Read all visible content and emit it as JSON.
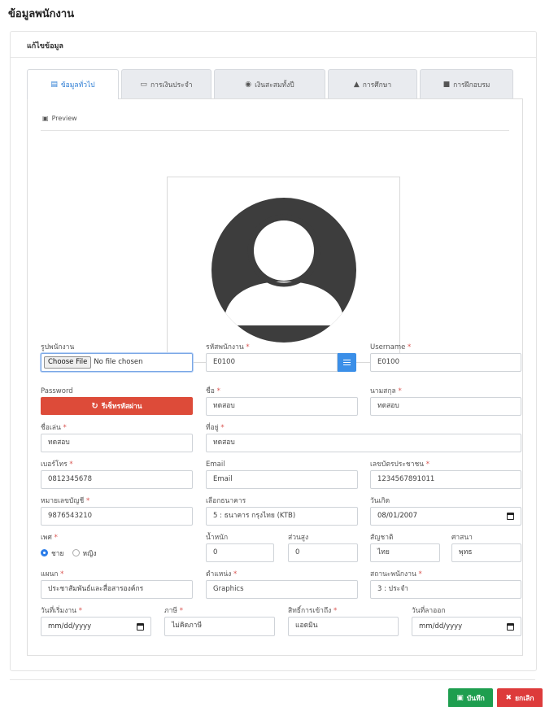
{
  "page_title": "ข้อมูลพนักงาน",
  "card_title": "แก้ไขข้อมูล",
  "tabs": [
    {
      "label": "ข้อมูลทั่วไป",
      "icon": "id-card-icon",
      "active": true
    },
    {
      "label": "การเงินประจำ",
      "icon": "money-icon",
      "active": false
    },
    {
      "label": "เงินสะสมทั้งปี",
      "icon": "piggy-bank-icon",
      "active": false
    },
    {
      "label": "การศึกษา",
      "icon": "graduation-cap-icon",
      "active": false
    },
    {
      "label": "การฝึกอบรม",
      "icon": "book-icon",
      "active": false
    }
  ],
  "preview_label": "Preview",
  "fields": {
    "photo": {
      "label": "รูปพนักงาน",
      "button": "Choose File",
      "status": "No file chosen"
    },
    "employee_code": {
      "label": "รหัสพนักงาน",
      "value": "E0100"
    },
    "username": {
      "label": "Username",
      "value": "E0100"
    },
    "password": {
      "label": "Password",
      "button": "รีเซ็ทรหัสผ่าน"
    },
    "first_name": {
      "label": "ชื่อ",
      "value": "ทดสอบ"
    },
    "last_name": {
      "label": "นามสกุล",
      "value": "ทดสอบ"
    },
    "nickname": {
      "label": "ชื่อเล่น",
      "value": "ทดสอบ"
    },
    "address": {
      "label": "ที่อยู่",
      "value": "ทดสอบ"
    },
    "phone": {
      "label": "เบอร์โทร",
      "value": "0812345678"
    },
    "email": {
      "label": "Email",
      "placeholder": "Email"
    },
    "id_card": {
      "label": "เลขบัตรประชาชน",
      "value": "1234567891011"
    },
    "account_no": {
      "label": "หมายเลขบัญชี",
      "value": "9876543210"
    },
    "bank": {
      "label": "เลือกธนาคาร",
      "value": "5 : ธนาคาร กรุงไทย (KTB)"
    },
    "birthday": {
      "label": "วันเกิด",
      "value": "08/01/2007"
    },
    "gender": {
      "label": "เพศ",
      "options": [
        "ชาย",
        "หญิง"
      ],
      "selected": "ชาย"
    },
    "weight": {
      "label": "น้ำหนัก",
      "value": "0"
    },
    "height": {
      "label": "ส่วนสูง",
      "value": "0"
    },
    "nationality": {
      "label": "สัญชาติ",
      "value": "ไทย"
    },
    "religion": {
      "label": "ศาสนา",
      "value": "พุทธ"
    },
    "department": {
      "label": "แผนก",
      "value": "ประชาสัมพันธ์และสื่อสารองค์กร"
    },
    "position": {
      "label": "ตำแหน่ง",
      "value": "Graphics"
    },
    "status": {
      "label": "สถานะพนักงาน",
      "value": "3 : ประจำ"
    },
    "start_date": {
      "label": "วันที่เริ่มงาน",
      "value": "mm/dd/yyyy"
    },
    "tax": {
      "label": "ภาษี",
      "value": "ไม่คิดภาษี"
    },
    "access": {
      "label": "สิทธิ์การเข้าถึง",
      "value": "แอดมิน"
    },
    "resign_date": {
      "label": "วันที่ลาออก",
      "value": "mm/dd/yyyy"
    }
  },
  "actions": {
    "save": "บันทึก",
    "cancel": "ยกเลิก"
  },
  "colors": {
    "primary": "#3b8fe8",
    "danger": "#dd4b39",
    "success": "#1e9e4f",
    "required": "#d9534f"
  }
}
